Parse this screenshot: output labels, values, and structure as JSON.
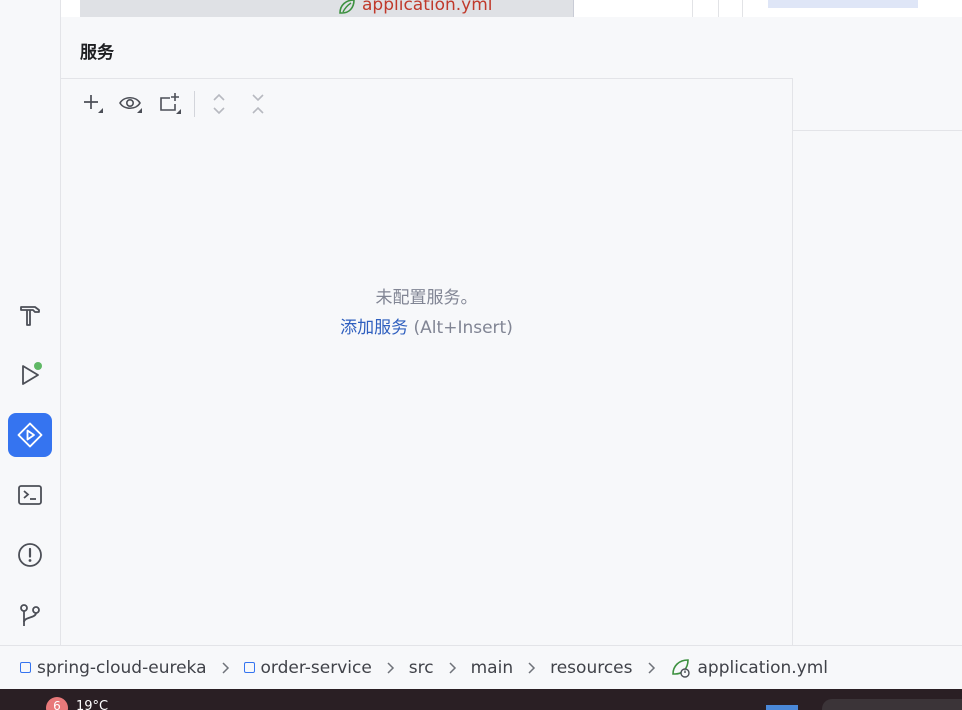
{
  "top_tab": {
    "label": "application.yml"
  },
  "sidebar": {
    "tools": [
      {
        "name": "build",
        "icon": "hammer-icon"
      },
      {
        "name": "run",
        "icon": "run-icon"
      },
      {
        "name": "services",
        "icon": "services-icon",
        "active": true
      },
      {
        "name": "terminal",
        "icon": "terminal-icon"
      },
      {
        "name": "problems",
        "icon": "problems-icon"
      },
      {
        "name": "git",
        "icon": "git-branch-icon"
      }
    ]
  },
  "services_panel": {
    "title": "服务",
    "toolbar": [
      {
        "icon": "add-icon"
      },
      {
        "icon": "eye-icon"
      },
      {
        "icon": "new-group-icon"
      },
      {
        "icon": "expand-all-icon"
      },
      {
        "icon": "collapse-all-icon"
      }
    ],
    "empty_message": "未配置服务。",
    "add_service_link": "添加服务",
    "add_service_shortcut": "(Alt+Insert)"
  },
  "breadcrumb": {
    "items": [
      "spring-cloud-eureka",
      "order-service",
      "src",
      "main",
      "resources",
      "application.yml"
    ]
  },
  "taskbar": {
    "badge": "6",
    "temperature": "19°C"
  },
  "colors": {
    "accent": "#3574f0",
    "link": "#2f5fbf",
    "muted_text": "#818594",
    "run_status_dot": "#5fb865",
    "yml_icon": "#3d9140"
  }
}
